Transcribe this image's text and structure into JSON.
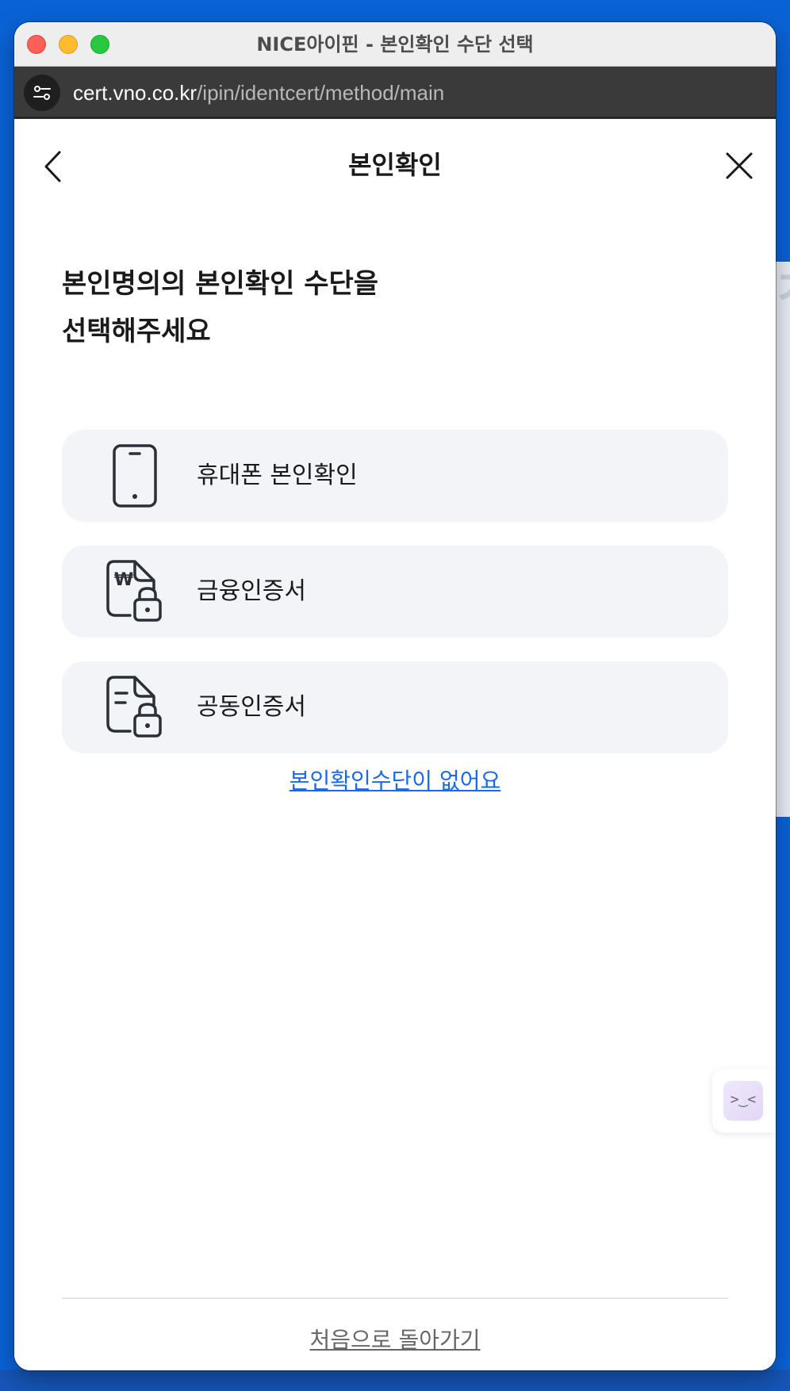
{
  "window": {
    "title": "NICE아이핀 - 본인확인 수단 선택"
  },
  "addressbar": {
    "url_host": "cert.vno.co.kr",
    "url_path": "/ipin/identcert/method/main"
  },
  "header": {
    "title": "본인확인"
  },
  "headline": {
    "line1": "본인명의의 본인확인 수단을",
    "line2": "선택해주세요"
  },
  "options": [
    {
      "label": "휴대폰 본인확인",
      "icon": "smartphone-icon"
    },
    {
      "label": "금융인증서",
      "icon": "won-document-lock-icon"
    },
    {
      "label": "공동인증서",
      "icon": "document-lock-icon"
    }
  ],
  "links": {
    "no_method": "본인확인수단이 없어요",
    "go_home": "처음으로 돌아가기"
  },
  "helper": {
    "face": ">‿<"
  },
  "colors": {
    "link_blue": "#1a6ae8",
    "option_bg": "#f2f4f7",
    "desktop_blue": "#0a63d6"
  }
}
